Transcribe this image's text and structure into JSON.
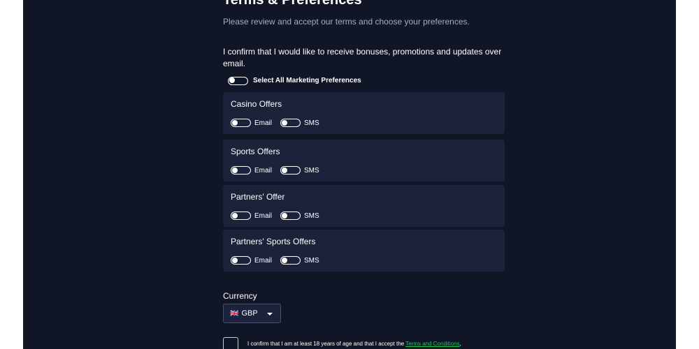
{
  "header": {
    "title": "Terms & Preferences",
    "subtitle": "Please review and accept our terms and choose your preferences."
  },
  "consent_text": "I confirm that I would like to receive bonuses, promotions and updates over email.",
  "select_all": {
    "label": "Select All Marketing Preferences",
    "checked": false
  },
  "groups": [
    {
      "title": "Casino Offers",
      "email_label": "Email",
      "sms_label": "SMS",
      "email_on": false,
      "sms_on": false
    },
    {
      "title": "Sports Offers",
      "email_label": "Email",
      "sms_label": "SMS",
      "email_on": false,
      "sms_on": false
    },
    {
      "title": "Partners' Offer",
      "email_label": "Email",
      "sms_label": "SMS",
      "email_on": false,
      "sms_on": false
    },
    {
      "title": "Partners' Sports Offers",
      "email_label": "Email",
      "sms_label": "SMS",
      "email_on": false,
      "sms_on": false
    }
  ],
  "currency": {
    "label": "Currency",
    "flag": "🇬🇧",
    "selected": "GBP"
  },
  "age_confirm": {
    "text": "I confirm that I am at least 18 years of age and that I accept the ",
    "link": "Terms and Conditions",
    "trail": ",",
    "checked": false
  },
  "colors": {
    "background": "#111627",
    "card": "#1b2239",
    "text": "#ffffff",
    "muted": "#a7adbb",
    "link": "#22c55e"
  }
}
